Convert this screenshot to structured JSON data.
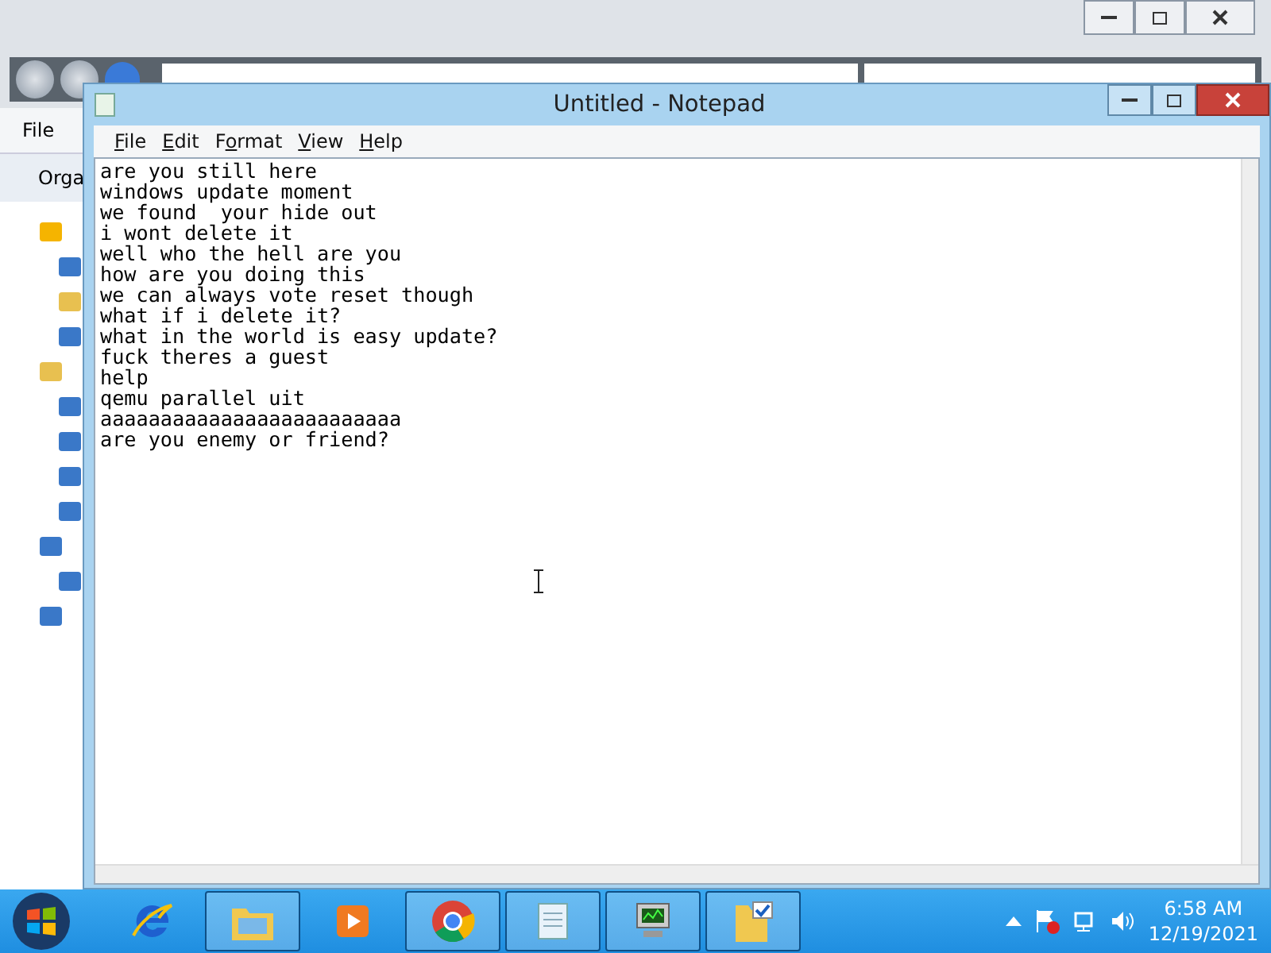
{
  "explorer": {
    "menu": [
      "File"
    ],
    "toolbar": [
      "Orga"
    ]
  },
  "notepad": {
    "title": "Untitled - Notepad",
    "menu": [
      {
        "access_key": "F",
        "rest": "ile"
      },
      {
        "access_key": "E",
        "rest": "dit"
      },
      {
        "lead": "F",
        "access_key": "o",
        "rest": "rmat"
      },
      {
        "access_key": "V",
        "rest": "iew"
      },
      {
        "access_key": "H",
        "rest": "elp"
      }
    ],
    "lines": [
      "are you still here",
      "windows update moment",
      "we found  your hide out",
      "i wont delete it",
      "well who the hell are you",
      "how are you doing this",
      "we can always vote reset though",
      "what if i delete it?",
      "what in the world is easy update?",
      "fuck theres a guest",
      "help",
      "qemu parallel uit",
      "aaaaaaaaaaaaaaaaaaaaaaaaa",
      "are you enemy or friend?"
    ]
  },
  "taskbar": {
    "buttons": [
      {
        "running": false
      },
      {
        "running": true
      },
      {
        "running": false
      },
      {
        "running": true
      },
      {
        "running": true
      },
      {
        "running": true
      },
      {
        "running": true
      }
    ],
    "clock": {
      "time": "6:58 AM",
      "date": "12/19/2021"
    }
  }
}
